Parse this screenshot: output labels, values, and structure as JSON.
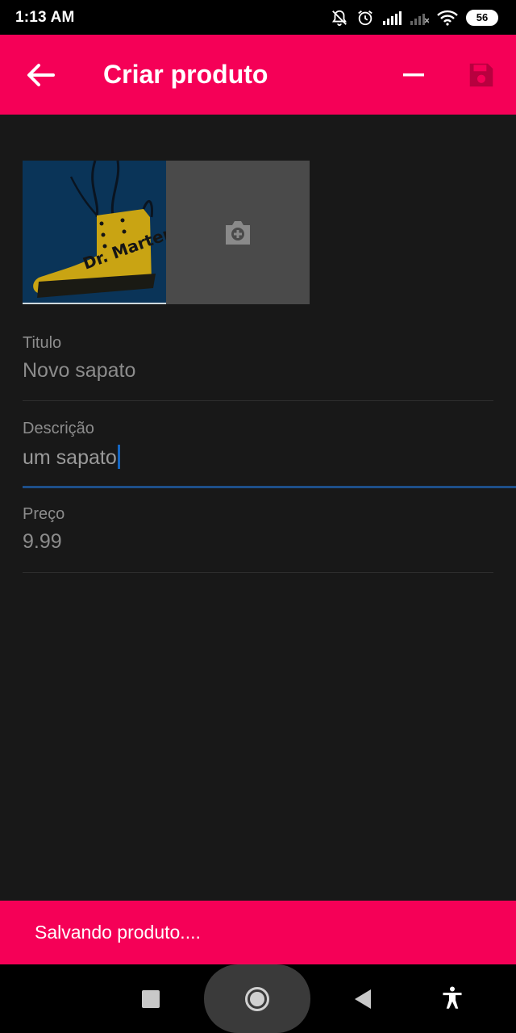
{
  "status_bar": {
    "time": "1:13 AM",
    "battery": "56",
    "icons": [
      "mute-bell-icon",
      "alarm-icon",
      "signal-icon",
      "signal-off-icon",
      "wifi-icon",
      "battery-icon"
    ]
  },
  "app_bar": {
    "title": "Criar produto",
    "back_icon": "arrow-back-icon",
    "minimize_icon": "minus-icon",
    "save_icon": "save-icon",
    "color": "#f50057"
  },
  "images": {
    "add_icon": "add-photo-icon"
  },
  "form": {
    "title": {
      "label": "Titulo",
      "value": "Novo sapato"
    },
    "description": {
      "label": "Descrição",
      "value": "um sapato"
    },
    "price": {
      "label": "Preço",
      "value": "9.99"
    }
  },
  "snackbar": {
    "message": "Salvando produto...."
  },
  "nav_bar": {
    "icons": [
      "recents-icon",
      "home-icon",
      "back-icon",
      "accessibility-icon"
    ]
  }
}
